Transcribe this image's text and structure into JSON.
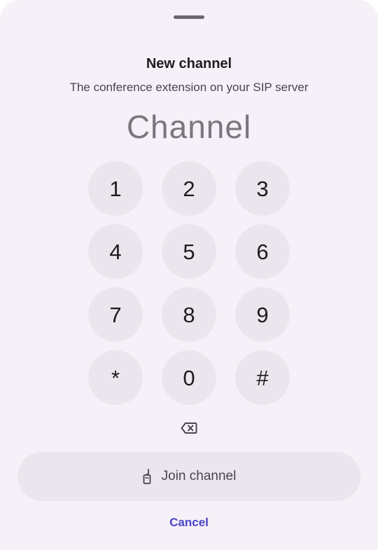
{
  "sheet": {
    "title": "New channel",
    "subtitle": "The conference extension on your SIP server",
    "channel_placeholder": "Channel"
  },
  "keypad": {
    "keys": [
      "1",
      "2",
      "3",
      "4",
      "5",
      "6",
      "7",
      "8",
      "9",
      "*",
      "0",
      "#"
    ]
  },
  "icons": {
    "backspace": "backspace-icon",
    "join": "walkie-talkie-icon"
  },
  "actions": {
    "join_label": "Join channel",
    "cancel_label": "Cancel"
  },
  "colors": {
    "background": "#f6f1f8",
    "key_background": "#ebe6ee",
    "accent": "#4a43c8",
    "text_primary": "#1d1b20",
    "text_secondary": "#49454f"
  }
}
